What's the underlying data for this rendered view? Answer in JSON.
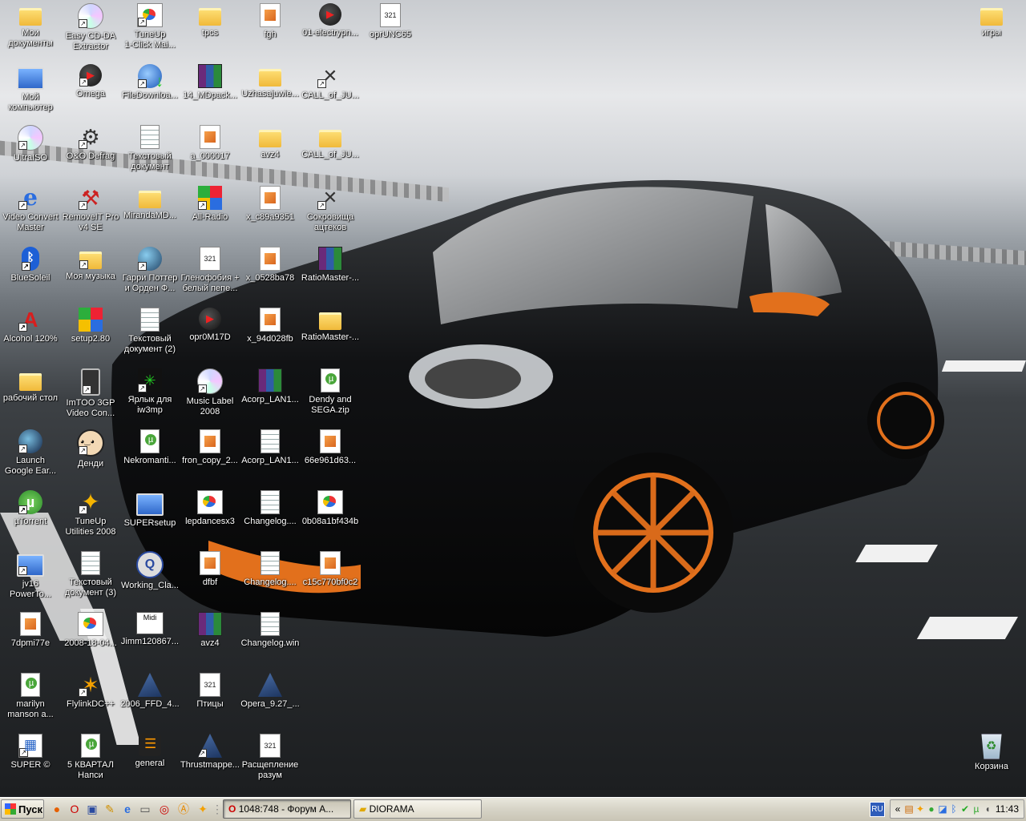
{
  "desktop_icons": [
    {
      "label": "Мои\nдокументы",
      "icon": "my-documents-icon",
      "kind": "folder",
      "shortcut": false
    },
    {
      "label": "Easy CD-DA\nExtractor",
      "icon": "cd-extractor-icon",
      "kind": "cd",
      "shortcut": true
    },
    {
      "label": "TuneUp\n1-Click Mai...",
      "icon": "tuneup-icon",
      "kind": "ppt",
      "shortcut": true
    },
    {
      "label": "tpcs",
      "icon": "folder-icon",
      "kind": "folder",
      "shortcut": false
    },
    {
      "label": "fgh",
      "icon": "media-file-icon",
      "kind": "media",
      "shortcut": false
    },
    {
      "label": "01-electrypn...",
      "icon": "mp3-icon",
      "kind": "mp3",
      "shortcut": false
    },
    {
      "label": "oprUNC65",
      "icon": "media-321-icon",
      "kind": "321",
      "shortcut": false
    },
    {
      "label": "игры",
      "icon": "folder-icon",
      "kind": "folder",
      "shortcut": false
    },
    {
      "label": "Мой\nкомпьютер",
      "icon": "my-computer-icon",
      "kind": "pc",
      "shortcut": false
    },
    {
      "label": "Omega",
      "icon": "omega-icon",
      "kind": "mp3",
      "shortcut": true
    },
    {
      "label": "FileDownloa...",
      "icon": "file-downloader-icon",
      "kind": "fdm",
      "shortcut": true
    },
    {
      "label": "14_MDpack...",
      "icon": "rar-archive-icon",
      "kind": "rar",
      "shortcut": false
    },
    {
      "label": "Uzhasajuwie...",
      "icon": "folder-icon",
      "kind": "folder",
      "shortcut": false
    },
    {
      "label": "CALL_of_JU...",
      "icon": "guns-icon",
      "kind": "guns",
      "shortcut": true
    },
    {
      "label": "UltraISO",
      "icon": "ultraiso-icon",
      "kind": "cd",
      "shortcut": true
    },
    {
      "label": "O&O Defrag",
      "icon": "defrag-icon",
      "kind": "gear",
      "shortcut": true
    },
    {
      "label": "Текстовый\nдокумент",
      "icon": "text-document-icon",
      "kind": "doc",
      "shortcut": false
    },
    {
      "label": "a_000017",
      "icon": "media-file-icon",
      "kind": "media",
      "shortcut": false
    },
    {
      "label": "avz4",
      "icon": "folder-icon",
      "kind": "folder",
      "shortcut": false
    },
    {
      "label": "CALL_of_JU...",
      "icon": "folder-icon",
      "kind": "folder",
      "shortcut": false
    },
    {
      "label": "Video Convert\nMaster",
      "icon": "ie-icon",
      "kind": "ie",
      "shortcut": true
    },
    {
      "label": "RemoveIT Pro\nv4 SE",
      "icon": "hammer-icon",
      "kind": "hammer",
      "shortcut": true
    },
    {
      "label": "MirandaMD...",
      "icon": "folder-icon",
      "kind": "folder",
      "shortcut": false
    },
    {
      "label": "All-Radio",
      "icon": "all-radio-icon",
      "kind": "apps",
      "shortcut": true
    },
    {
      "label": "x_c89a9351",
      "icon": "media-file-icon",
      "kind": "media",
      "shortcut": false
    },
    {
      "label": "Сокровища\nацтеков",
      "icon": "guns-icon",
      "kind": "guns",
      "shortcut": true
    },
    {
      "label": "BlueSoleil",
      "icon": "bluetooth-icon",
      "kind": "bt",
      "shortcut": true
    },
    {
      "label": "Моя музыка",
      "icon": "my-music-icon",
      "kind": "folder",
      "shortcut": true
    },
    {
      "label": "Гарри Поттер\nи Орден Ф...",
      "icon": "game-orb-icon",
      "kind": "orb",
      "shortcut": true
    },
    {
      "label": "Гленофобия +\nбелый пепе...",
      "icon": "media-321-icon",
      "kind": "321",
      "shortcut": false
    },
    {
      "label": "x_0528ba78",
      "icon": "media-file-icon",
      "kind": "media",
      "shortcut": false
    },
    {
      "label": "RatioMaster-...",
      "icon": "rar-archive-icon",
      "kind": "rar",
      "shortcut": false
    },
    {
      "label": "Alcohol 120%",
      "icon": "alcohol-icon",
      "kind": "alcohol",
      "shortcut": true
    },
    {
      "label": "setup2.80",
      "icon": "setup-icon",
      "kind": "apps",
      "shortcut": false
    },
    {
      "label": "Текстовый\nдокумент (2)",
      "icon": "text-document-icon",
      "kind": "doc",
      "shortcut": false
    },
    {
      "label": "opr0M17D",
      "icon": "mp3-icon",
      "kind": "mp3",
      "shortcut": false
    },
    {
      "label": "x_94d028fb",
      "icon": "media-file-icon",
      "kind": "media",
      "shortcut": false
    },
    {
      "label": "RatioMaster-...",
      "icon": "folder-icon",
      "kind": "folder",
      "shortcut": false
    },
    {
      "label": "рабочий стол",
      "icon": "folder-icon",
      "kind": "folder",
      "shortcut": false
    },
    {
      "label": "ImTOO 3GP\nVideo Con...",
      "icon": "phone-icon",
      "kind": "phone",
      "shortcut": true
    },
    {
      "label": "Ярлык для\niw3mp",
      "icon": "game-icon",
      "kind": "wm",
      "shortcut": true
    },
    {
      "label": "Music Label\n2008",
      "icon": "cd-icon",
      "kind": "cd",
      "shortcut": true
    },
    {
      "label": "Acorp_LAN1...",
      "icon": "rar-archive-icon",
      "kind": "rar",
      "shortcut": false
    },
    {
      "label": "Dendy and\nSEGA.zip",
      "icon": "torrent-file-icon",
      "kind": "torrent",
      "shortcut": false
    },
    {
      "label": "Launch\nGoogle Ear...",
      "icon": "google-earth-icon",
      "kind": "earth",
      "shortcut": true
    },
    {
      "label": "Денди",
      "icon": "dendi-icon",
      "kind": "dendi",
      "shortcut": true
    },
    {
      "label": "Nekromanti...",
      "icon": "torrent-file-icon",
      "kind": "torrent",
      "shortcut": false
    },
    {
      "label": "fron_copy_2...",
      "icon": "media-file-icon",
      "kind": "media",
      "shortcut": false
    },
    {
      "label": "Acorp_LAN1...",
      "icon": "dll-icon",
      "kind": "doc",
      "shortcut": false
    },
    {
      "label": "66e961d63...",
      "icon": "media-file-icon",
      "kind": "media",
      "shortcut": false
    },
    {
      "label": "µTorrent",
      "icon": "utorrent-icon",
      "kind": "utorrent",
      "shortcut": true
    },
    {
      "label": "TuneUp\nUtilities 2008",
      "icon": "tuneup-utilities-icon",
      "kind": "tune",
      "shortcut": true
    },
    {
      "label": "SUPERsetup",
      "icon": "super-setup-icon",
      "kind": "pc",
      "shortcut": false
    },
    {
      "label": "lepdancesx3",
      "icon": "image-file-icon",
      "kind": "ppt",
      "shortcut": false
    },
    {
      "label": "Changelog....",
      "icon": "text-document-icon",
      "kind": "doc",
      "shortcut": false
    },
    {
      "label": "0b08a1bf434b",
      "icon": "image-file-icon",
      "kind": "ppt",
      "shortcut": false
    },
    {
      "label": "jv16\nPowerTo...",
      "icon": "jv16-icon",
      "kind": "pc",
      "shortcut": true
    },
    {
      "label": "Текстовый\nдокумент (3)",
      "icon": "text-document-icon",
      "kind": "doc",
      "shortcut": false
    },
    {
      "label": "Working_Cla...",
      "icon": "working-icon",
      "kind": "working",
      "shortcut": false
    },
    {
      "label": "dfbf",
      "icon": "media-file-icon",
      "kind": "media",
      "shortcut": false
    },
    {
      "label": "Changelog....",
      "icon": "text-document-icon",
      "kind": "doc",
      "shortcut": false
    },
    {
      "label": "c15c770bf0c2",
      "icon": "media-file-icon",
      "kind": "media",
      "shortcut": false
    },
    {
      "label": "7dpmi77e",
      "icon": "media-file-icon",
      "kind": "media",
      "shortcut": false
    },
    {
      "label": "2008-18-04...",
      "icon": "image-file-icon",
      "kind": "ppt",
      "shortcut": false
    },
    {
      "label": "Jimm120867...",
      "icon": "midi-icon",
      "kind": "midi",
      "shortcut": false
    },
    {
      "label": "avz4",
      "icon": "rar-archive-icon",
      "kind": "rar",
      "shortcut": false
    },
    {
      "label": "Changelog.win",
      "icon": "text-document-icon",
      "kind": "doc",
      "shortcut": false
    },
    {
      "label": "marilyn\nmanson a...",
      "icon": "torrent-file-icon",
      "kind": "torrent",
      "shortcut": false
    },
    {
      "label": "FlylinkDC++",
      "icon": "flylink-icon",
      "kind": "flylink",
      "shortcut": true
    },
    {
      "label": "2006_FFD_4...",
      "icon": "opera-file-icon",
      "kind": "opera",
      "shortcut": false
    },
    {
      "label": "Птицы",
      "icon": "media-321-icon",
      "kind": "321",
      "shortcut": false
    },
    {
      "label": "Opera_9.27_...",
      "icon": "opera-file-icon",
      "kind": "opera",
      "shortcut": false
    },
    {
      "label": "SUPER ©",
      "icon": "super-icon",
      "kind": "super",
      "shortcut": true
    },
    {
      "label": "5 КВАРТАЛ\nНапси",
      "icon": "torrent-file-icon",
      "kind": "torrent",
      "shortcut": false
    },
    {
      "label": "general",
      "icon": "miranda-icon",
      "kind": "miranda",
      "shortcut": false
    },
    {
      "label": "Thrustmappe...",
      "icon": "opera-file-icon",
      "kind": "opera",
      "shortcut": true
    },
    {
      "label": "Расщепление\nразум",
      "icon": "media-321-icon",
      "kind": "321",
      "shortcut": false
    },
    {
      "label": "Корзина",
      "icon": "recycle-bin-icon",
      "kind": "recycle",
      "shortcut": false
    }
  ],
  "taskbar": {
    "start_label": "Пуск",
    "quick_launch": [
      "firefox-icon",
      "opera-icon",
      "save-icon",
      "edit-icon",
      "ie-icon",
      "disk-icon",
      "opera-red-icon",
      "avast-icon",
      "flylink-icon",
      "player-icon"
    ],
    "tasks": [
      {
        "label": "1048:748 - Форум А...",
        "icon": "opera-icon",
        "active": true
      },
      {
        "label": "DIORAMA",
        "icon": "folder-icon",
        "active": false
      }
    ],
    "language": "RU",
    "expand_tray": "«",
    "clock": "11:43"
  }
}
